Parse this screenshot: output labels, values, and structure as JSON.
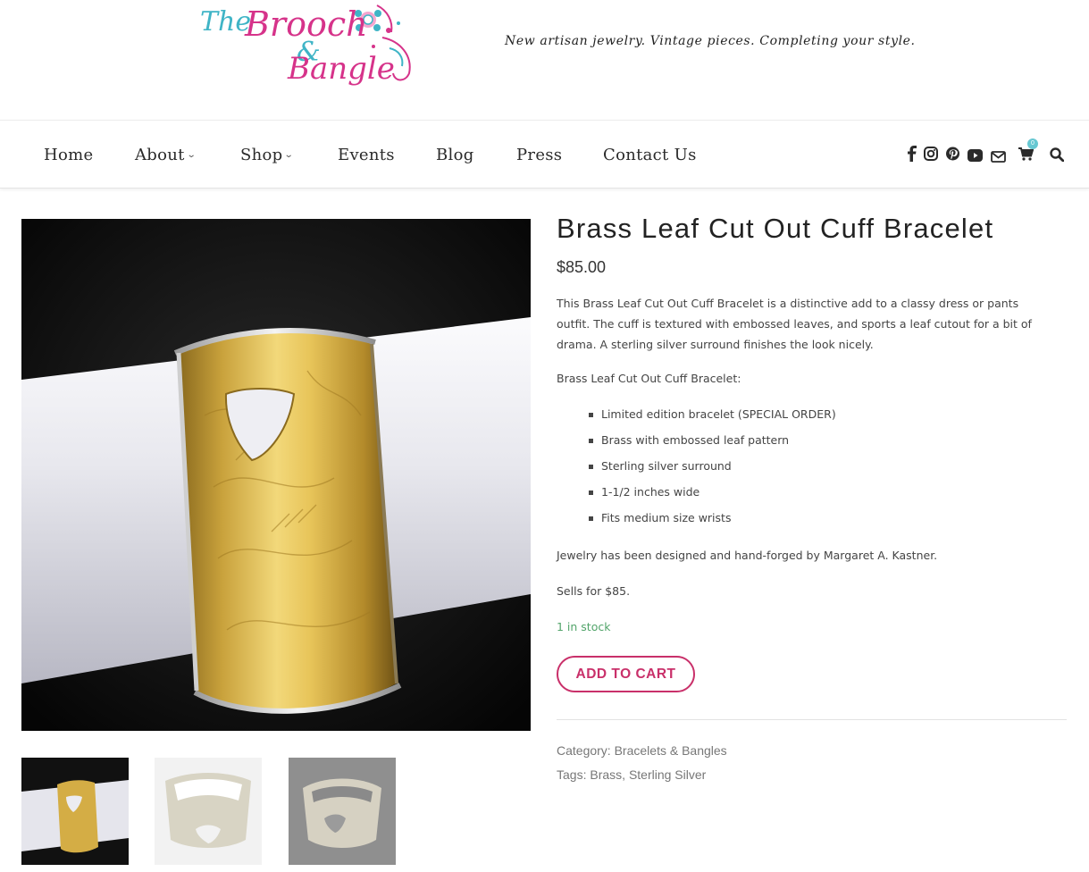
{
  "header": {
    "logo_text": "The Brooch & Bangle",
    "tagline": "New artisan jewelry. Vintage pieces. Completing your style."
  },
  "nav": {
    "home": "Home",
    "about": "About",
    "shop": "Shop",
    "events": "Events",
    "blog": "Blog",
    "press": "Press",
    "contact": "Contact Us",
    "cart_count": "0"
  },
  "social_icons": [
    "facebook-icon",
    "instagram-icon",
    "pinterest-icon",
    "youtube-icon",
    "envelope-icon",
    "cart-icon",
    "search-icon"
  ],
  "product": {
    "title": "Brass Leaf Cut Out Cuff Bracelet",
    "price": "$85.00",
    "description": "This Brass Leaf Cut Out Cuff Bracelet is a distinctive add to a classy dress or pants outfit.  The cuff is textured with embossed leaves, and sports a leaf cutout for a bit of drama.  A sterling silver surround finishes the look nicely.",
    "features_heading": "Brass Leaf Cut Out Cuff Bracelet:",
    "features": [
      "Limited edition bracelet (SPECIAL ORDER)",
      "Brass with embossed leaf pattern",
      "Sterling silver surround",
      "1-1/2 inches wide",
      "Fits medium size wrists"
    ],
    "designer": "Jewelry has been designed and hand-forged by Margaret A. Kastner.",
    "sells_for": "Sells for $85.",
    "stock": "1 in stock",
    "add_to_cart": "ADD TO CART",
    "category_label": "Category:",
    "category": "Bracelets & Bangles",
    "tags_label": "Tags:",
    "tag_1": "Brass",
    "tag_separator": ",",
    "tag_2": "Sterling Silver"
  },
  "colors": {
    "accent_pink": "#c9306a",
    "stock_green": "#52a46a",
    "logo_teal": "#3fb4c6",
    "logo_magenta": "#d6338a",
    "badge_teal": "#67c8d2"
  }
}
